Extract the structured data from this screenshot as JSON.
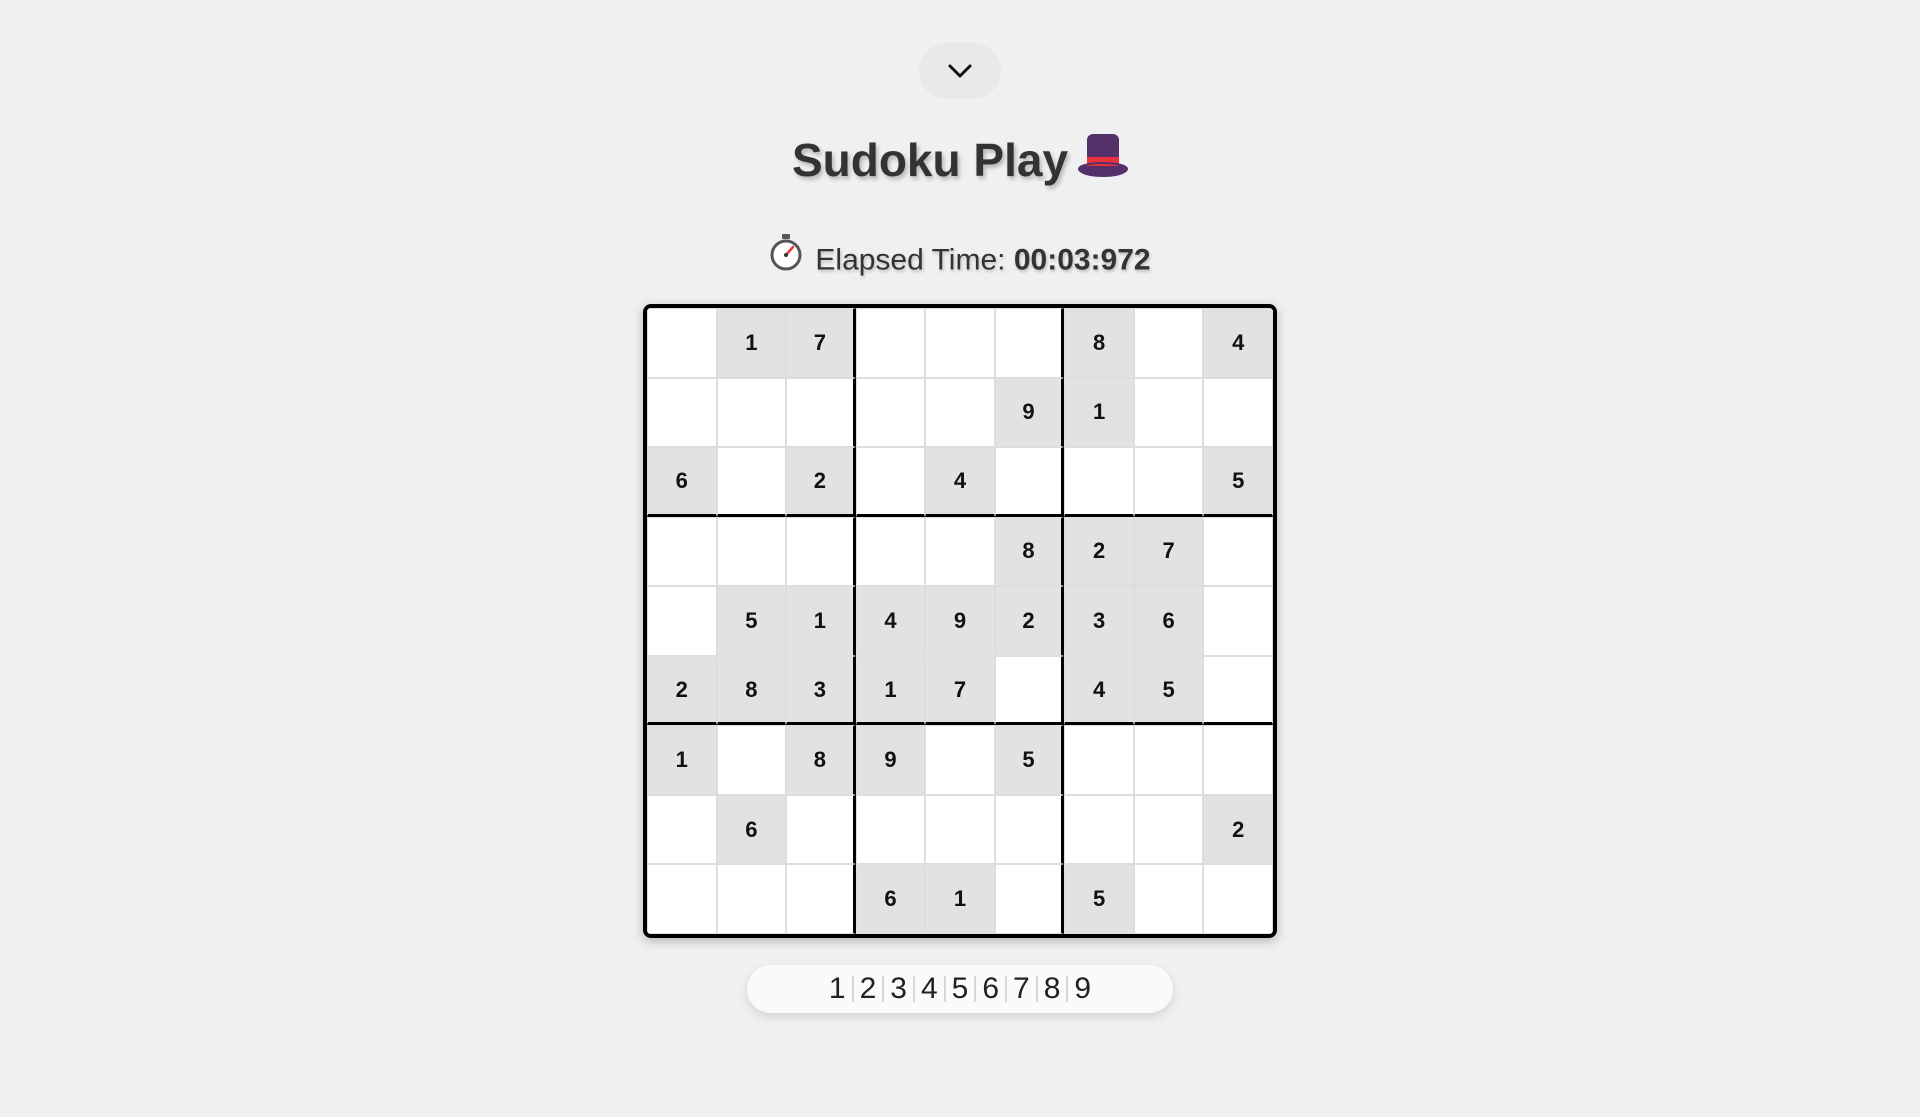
{
  "header": {
    "title": "Sudoku Play",
    "title_icon": "top-hat-icon",
    "toggle_icon": "chevron-down-icon"
  },
  "timer": {
    "icon": "stopwatch-icon",
    "label": "Elapsed Time:",
    "value": "00:03:972"
  },
  "board": {
    "rows": [
      [
        "",
        "1",
        "7",
        "",
        "",
        "",
        "8",
        "",
        "4"
      ],
      [
        "",
        "",
        "",
        "",
        "",
        "9",
        "1",
        "",
        ""
      ],
      [
        "6",
        "",
        "2",
        "",
        "4",
        "",
        "",
        "",
        "5"
      ],
      [
        "",
        "",
        "",
        "",
        "",
        "8",
        "2",
        "7",
        ""
      ],
      [
        "",
        "5",
        "1",
        "4",
        "9",
        "2",
        "3",
        "6",
        ""
      ],
      [
        "2",
        "8",
        "3",
        "1",
        "7",
        "",
        "4",
        "5",
        ""
      ],
      [
        "1",
        "",
        "8",
        "9",
        "",
        "5",
        "",
        "",
        ""
      ],
      [
        "",
        "6",
        "",
        "",
        "",
        "",
        "",
        "",
        "2"
      ],
      [
        "",
        "",
        "",
        "6",
        "1",
        "",
        "5",
        "",
        ""
      ]
    ]
  },
  "numpad": {
    "numbers": [
      "1",
      "2",
      "3",
      "4",
      "5",
      "6",
      "7",
      "8",
      "9"
    ]
  },
  "colors": {
    "background": "#f0f0f0",
    "given_cell": "#e2e2e2",
    "empty_cell": "#ffffff",
    "hat_body": "#55316a",
    "hat_band": "#e8323c"
  }
}
